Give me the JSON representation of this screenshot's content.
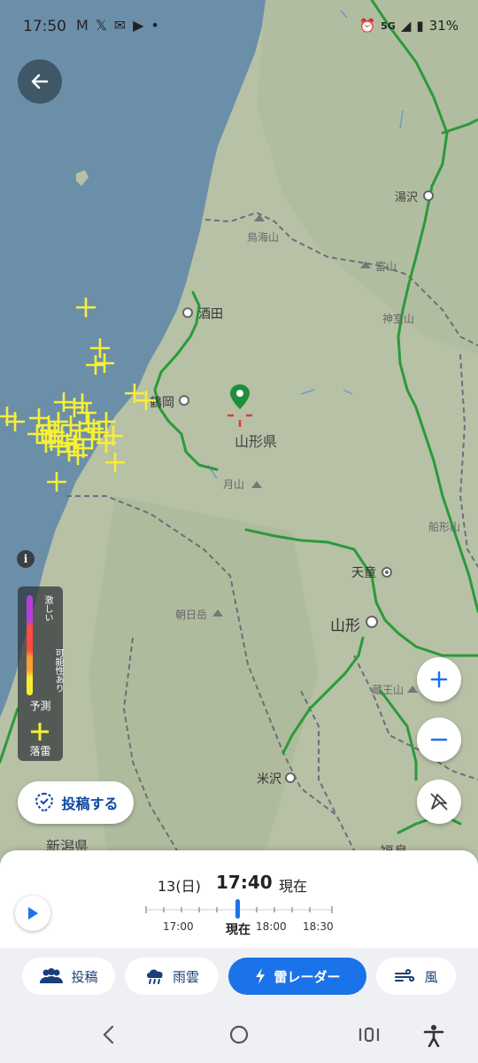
{
  "status": {
    "time": "17:50",
    "battery": "31%",
    "network": "5G",
    "left_icons": [
      "gmail-icon",
      "x-icon",
      "mail-icon",
      "youtube-icon",
      "dot-icon"
    ]
  },
  "map": {
    "places": {
      "yuzawa": "湯沢",
      "chokaisan": "鳥海山",
      "sakata": "酒田",
      "kamuro": "神室山",
      "tsuruoka": "鶴岡",
      "yamagata_pref": "山形県",
      "gassan": "月山",
      "funagata": "船形山",
      "tendo": "天童",
      "asahidake": "朝日岳",
      "yamagata_city": "山形",
      "zaosan": "蔵王山",
      "yonezawa": "米沢",
      "niigata_pref": "新潟県",
      "fukushima": "福島"
    }
  },
  "legend": {
    "strong": "激しい",
    "possible": "可能性あり",
    "forecast": "予測",
    "strike": "落雷"
  },
  "info_label": "i",
  "buttons": {
    "post": "投稿する"
  },
  "timeline": {
    "date": "13(日)",
    "time": "17:40",
    "now": "現在",
    "ticks": [
      "17:00",
      "現在",
      "18:00",
      "18:30"
    ]
  },
  "tabs": [
    {
      "label": "投稿",
      "icon": "people-icon"
    },
    {
      "label": "雨雲",
      "icon": "rain-cloud-icon"
    },
    {
      "label": "雷レーダー",
      "icon": "lightning-icon",
      "active": true
    },
    {
      "label": "風",
      "icon": "wind-icon"
    }
  ],
  "colors": {
    "accent": "#1a73e8",
    "sea": "#6c8fa9",
    "land": "#b7c1a6",
    "lightning_strike": "#f7ef34"
  }
}
